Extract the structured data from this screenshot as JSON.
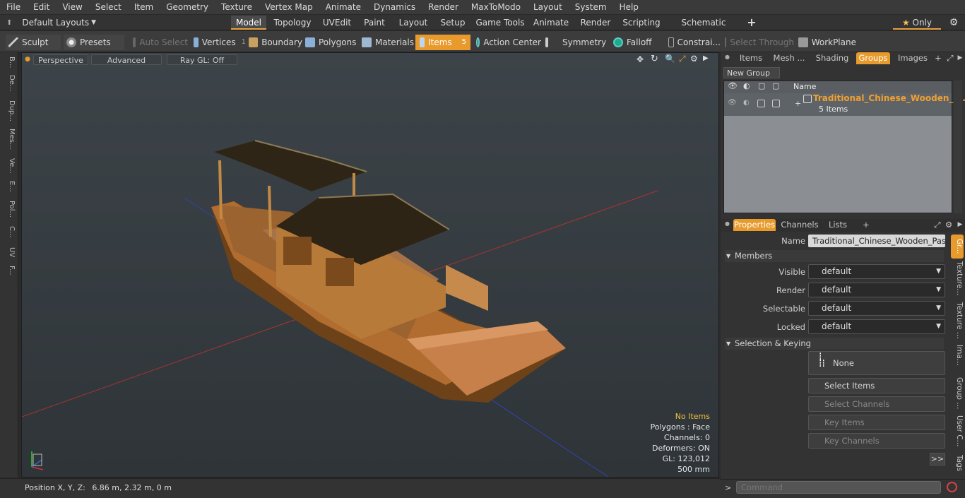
{
  "menu": [
    "File",
    "Edit",
    "View",
    "Select",
    "Item",
    "Geometry",
    "Texture",
    "Vertex Map",
    "Animate",
    "Dynamics",
    "Render",
    "MaxToModo",
    "Layout",
    "System",
    "Help"
  ],
  "layouts_label": "Default Layouts",
  "main_tabs": [
    "Model",
    "Topology",
    "UVEdit",
    "Paint",
    "Layout",
    "Setup",
    "Game Tools",
    "Animate",
    "Render",
    "Scripting",
    "Schematic Fusion"
  ],
  "only_label": "Only",
  "toolbar": {
    "sculpt": "Sculpt",
    "presets": "Presets",
    "auto_select": "Auto Select",
    "vertices": "Vertices",
    "vertices_count": "1",
    "boundary": "Boundary",
    "polygons": "Polygons",
    "materials": "Materials",
    "items": "Items",
    "items_count": "5",
    "action_center": "Action Center",
    "symmetry": "Symmetry",
    "falloff": "Falloff",
    "constraints": "Constrai...",
    "select_through": "Select Through",
    "workplane": "WorkPlane"
  },
  "left_tabs": [
    "B...",
    "De...",
    "Dup...",
    "Mes...",
    "Ve...",
    "E...",
    "Pol...",
    "C...",
    "UV",
    "F..."
  ],
  "viewport": {
    "perspective": "Perspective",
    "advanced": "Advanced",
    "raygl": "Ray GL: Off",
    "hud_selection": "No Items",
    "hud_polygons": "Polygons : Face",
    "hud_channels": "Channels: 0",
    "hud_deformers": "Deformers: ON",
    "hud_gl": "GL: 123,012",
    "hud_scale": "500 mm"
  },
  "status": {
    "position_label": "Position X, Y, Z:",
    "position_value": "6.86 m, 2.32 m, 0 m"
  },
  "right_top_tabs": [
    "Items",
    "Mesh ...",
    "Shading",
    "Groups",
    "Images"
  ],
  "new_group_label": "New Group",
  "group_list": {
    "name_header": "Name",
    "group_name": "Traditional_Chinese_Wooden_P ...",
    "group_count": "5 Items"
  },
  "props_tabs": [
    "Properties",
    "Channels",
    "Lists"
  ],
  "properties": {
    "name_label": "Name",
    "name_value": "Traditional_Chinese_Wooden_Passeng",
    "members_header": "Members",
    "visible_label": "Visible",
    "render_label": "Render",
    "selectable_label": "Selectable",
    "locked_label": "Locked",
    "default_value": "default",
    "sel_keying_header": "Selection & Keying",
    "none_label": "None",
    "select_items": "Select Items",
    "select_channels": "Select Channels",
    "key_items": "Key Items",
    "key_channels": "Key Channels",
    "more": ">>"
  },
  "right_side_tabs": [
    "Gr...",
    "Texture...",
    "Texture ...",
    "Ima...",
    "Group ...",
    "User C...",
    "Tags"
  ],
  "command_placeholder": "Command",
  "colors": {
    "accent": "#e89a2c",
    "group_name": "#f0a030"
  }
}
